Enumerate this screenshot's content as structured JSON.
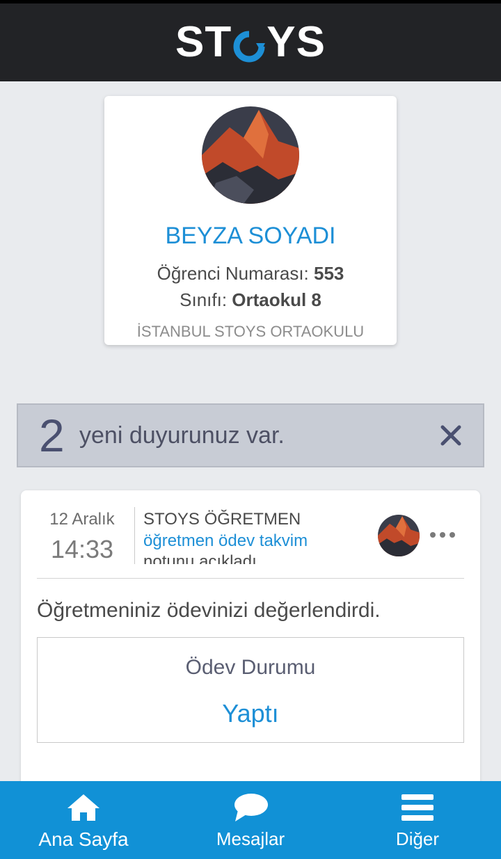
{
  "app": {
    "logo_text_left": "ST",
    "logo_text_right": "YS",
    "logo_accent": "#1d8fd6"
  },
  "profile": {
    "name": "BEYZA SOYADI",
    "number_label": "Öğrenci Numarası:",
    "number_value": "553",
    "class_label": "Sınıfı:",
    "class_value": "Ortaokul 8",
    "school": "İSTANBUL STOYS ORTAOKULU",
    "avatar_icon": "mountain-photo"
  },
  "announcement": {
    "count": "2",
    "message": "yeni duyurunuz var.",
    "close_icon": "close-icon"
  },
  "feed": {
    "date": "12 Aralık",
    "time": "14:33",
    "author": "STOYS ÖĞRETMEN",
    "action_link": "öğretmen ödev takvim",
    "action_rest": "notunu açıkladı",
    "text": "Öğretmeniniz ödevinizi değerlendirdi.",
    "status_label": "Ödev Durumu",
    "status_value": "Yaptı"
  },
  "nav": {
    "items": [
      {
        "label": "Ana Sayfa",
        "icon": "home-icon"
      },
      {
        "label": "Mesajlar",
        "icon": "chat-icon"
      },
      {
        "label": "Diğer",
        "icon": "menu-icon"
      }
    ]
  },
  "colors": {
    "topbar": "#222326",
    "accent": "#1d8fd6",
    "nav": "#1191d6",
    "background": "#e9ebee"
  }
}
